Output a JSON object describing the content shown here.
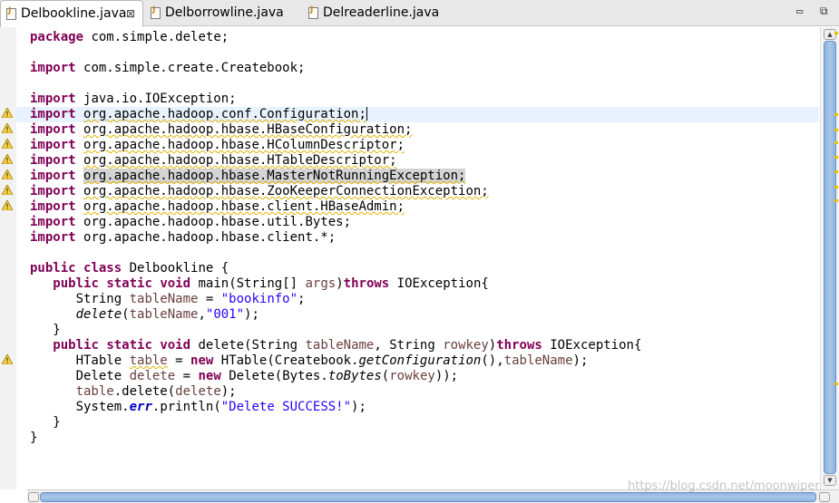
{
  "tabs": [
    {
      "label": "Delbookline.java",
      "active": true,
      "close": "⊠"
    },
    {
      "label": "Delborrowline.java",
      "active": false
    },
    {
      "label": "Delreaderline.java",
      "active": false
    }
  ],
  "window_controls": {
    "minimize": "▭",
    "restore": "⧉"
  },
  "code": {
    "package_kw": "package",
    "package_name": "com.simple.delete;",
    "import_kw": "import",
    "imports": [
      "com.simple.create.Createbook;",
      "java.io.IOException;",
      "org.apache.hadoop.conf.Configuration;",
      "org.apache.hadoop.hbase.HBaseConfiguration;",
      "org.apache.hadoop.hbase.HColumnDescriptor;",
      "org.apache.hadoop.hbase.HTableDescriptor;",
      "org.apache.hadoop.hbase.MasterNotRunningException;",
      "org.apache.hadoop.hbase.ZooKeeperConnectionException;",
      "org.apache.hadoop.hbase.client.HBaseAdmin;",
      "org.apache.hadoop.hbase.util.Bytes;",
      "org.apache.hadoop.hbase.client.*;"
    ],
    "t": {
      "public": "public",
      "class": "class",
      "static": "static",
      "void": "void",
      "throws": "throws",
      "new": "new",
      "class_name": "Delbookline",
      "open_brace": " {",
      "close_brace": "}",
      "main": "main(String[] ",
      "args": "args",
      "main_throws": " IOException{",
      "string_decl": "String ",
      "tableName": "tableName",
      "eq": " = ",
      "bookinfo": "\"bookinfo\"",
      "semi": ";",
      "delete_call": "delete",
      "call_open": "(",
      "comma": ",",
      "id001": "\"001\"",
      "call_end": ");",
      "delete_sig": "delete(String ",
      "tableName_p": "tableName",
      "sig_mid": ", String ",
      "rowkey": "rowkey",
      "sig_end": ") ",
      "delete_throws": " IOException{",
      "htable_type": "HTable ",
      "table": "table",
      "htable_ctor": " HTable(Createbook.",
      "getConfiguration": "getConfiguration",
      "paren_comma": "(),",
      "htable_end": ");",
      "delete_type": "Delete ",
      "delete_var": "delete",
      "delete_ctor": " Delete(Bytes.",
      "toBytes": "toBytes",
      "paren_open": "(",
      "rowkey_arg": "rowkey",
      "dbl_close": "));",
      "table_var": "table",
      "dot_delete": ".delete(",
      "delete_arg": "delete",
      "stmt_end": ");",
      "system": "System.",
      "err": "err",
      "println": ".println(",
      "success": "\"Delete SUCCESS!\"",
      "println_end": ");",
      "inner_close": "}",
      "outer_close": "}"
    }
  },
  "watermark": "https://blog.csdn.net/moonwiper"
}
